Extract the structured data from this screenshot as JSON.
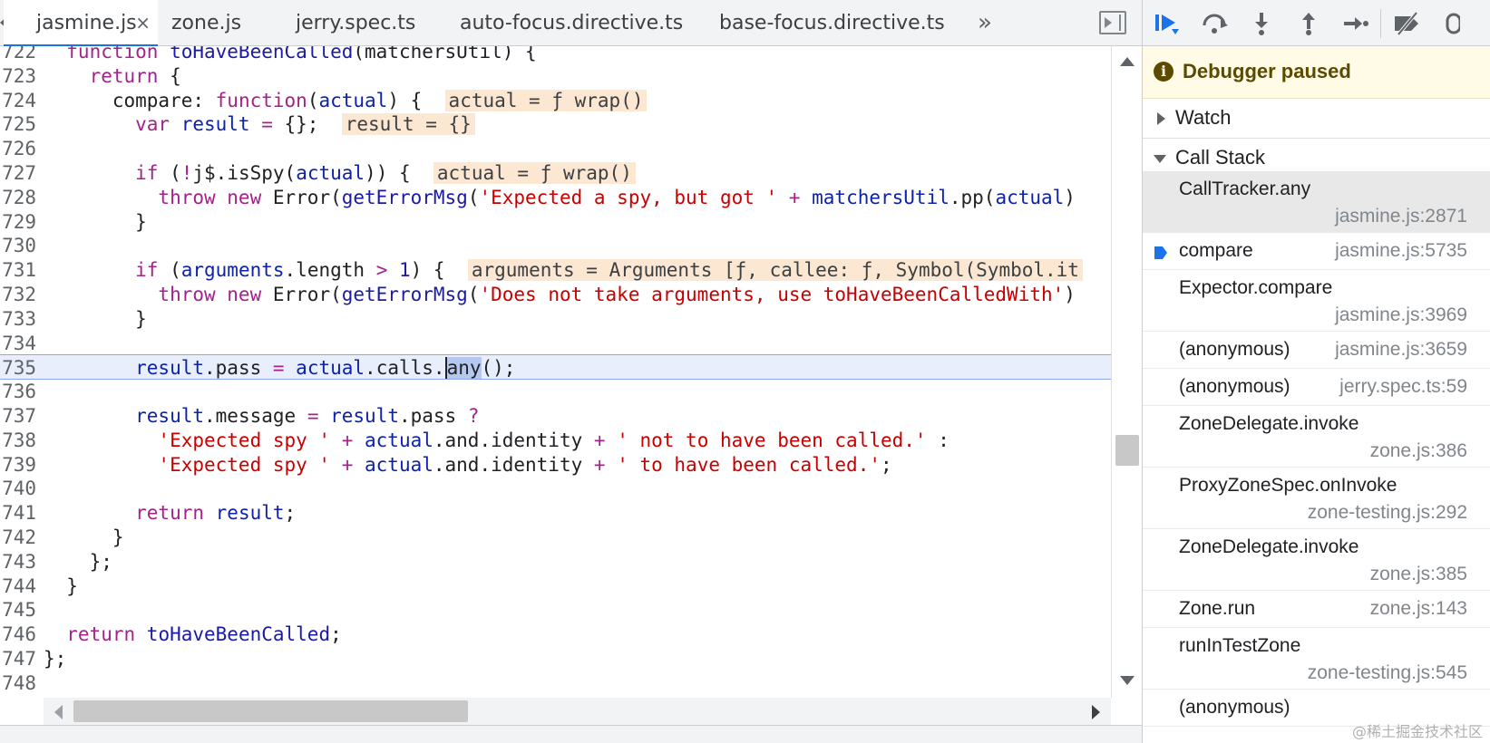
{
  "tabs": [
    {
      "label": "jasmine.js",
      "active": true,
      "close": "×"
    },
    {
      "label": "zone.js"
    },
    {
      "label": "jerry.spec.ts"
    },
    {
      "label": "auto-focus.directive.ts"
    },
    {
      "label": "base-focus.directive.ts"
    }
  ],
  "tabbar": {
    "more_icon": "»"
  },
  "code": {
    "lines": [
      {
        "n": "722",
        "tokens": [
          [
            "kw",
            "  function "
          ],
          [
            "fn",
            "toHaveBeenCalled"
          ],
          [
            "id",
            "(matchersUtil) {"
          ]
        ]
      },
      {
        "n": "723",
        "tokens": [
          [
            "kw",
            "    return "
          ],
          [
            "id",
            "{"
          ]
        ]
      },
      {
        "n": "724",
        "tokens": [
          [
            "id",
            "      compare: "
          ],
          [
            "kw",
            "function"
          ],
          [
            "id",
            "("
          ],
          [
            "prop",
            "actual"
          ],
          [
            "id",
            ") {  "
          ],
          [
            "ann",
            "actual = ƒ wrap()"
          ]
        ]
      },
      {
        "n": "725",
        "tokens": [
          [
            "kw",
            "        var "
          ],
          [
            "prop",
            "result"
          ],
          [
            "op",
            " = "
          ],
          [
            "id",
            "{};  "
          ],
          [
            "ann",
            "result = {}"
          ]
        ]
      },
      {
        "n": "726",
        "tokens": []
      },
      {
        "n": "727",
        "tokens": [
          [
            "kw",
            "        if "
          ],
          [
            "id",
            "("
          ],
          [
            "op",
            "!"
          ],
          [
            "id",
            "j$.isSpy("
          ],
          [
            "prop",
            "actual"
          ],
          [
            "id",
            ")) {  "
          ],
          [
            "ann",
            "actual = ƒ wrap()"
          ]
        ]
      },
      {
        "n": "728",
        "tokens": [
          [
            "kw",
            "          throw new "
          ],
          [
            "id",
            "Error("
          ],
          [
            "fn",
            "getErrorMsg"
          ],
          [
            "id",
            "("
          ],
          [
            "str",
            "'Expected a spy, but got '"
          ],
          [
            "op",
            " + "
          ],
          [
            "prop",
            "matchersUtil"
          ],
          [
            "id",
            ".pp("
          ],
          [
            "prop",
            "actual"
          ],
          [
            "id",
            ")"
          ]
        ]
      },
      {
        "n": "729",
        "tokens": [
          [
            "id",
            "        }"
          ]
        ]
      },
      {
        "n": "730",
        "tokens": []
      },
      {
        "n": "731",
        "tokens": [
          [
            "kw",
            "        if "
          ],
          [
            "id",
            "("
          ],
          [
            "prop",
            "arguments"
          ],
          [
            "id",
            ".length "
          ],
          [
            "op",
            ">"
          ],
          [
            "num",
            " 1"
          ],
          [
            "id",
            ") {  "
          ],
          [
            "ann",
            "arguments = Arguments [ƒ, callee: ƒ, Symbol(Symbol.it"
          ]
        ]
      },
      {
        "n": "732",
        "tokens": [
          [
            "kw",
            "          throw new "
          ],
          [
            "id",
            "Error("
          ],
          [
            "fn",
            "getErrorMsg"
          ],
          [
            "id",
            "("
          ],
          [
            "str",
            "'Does not take arguments, use toHaveBeenCalledWith'"
          ],
          [
            "id",
            ")"
          ]
        ]
      },
      {
        "n": "733",
        "tokens": [
          [
            "id",
            "        }"
          ]
        ]
      },
      {
        "n": "734",
        "tokens": []
      },
      {
        "n": "735",
        "current": true,
        "tokens": [
          [
            "prop",
            "        result"
          ],
          [
            "id",
            ".pass "
          ],
          [
            "op",
            "="
          ],
          [
            "prop",
            " actual"
          ],
          [
            "id",
            ".calls."
          ],
          [
            "sel",
            "any"
          ],
          [
            "id",
            "();"
          ]
        ]
      },
      {
        "n": "736",
        "tokens": []
      },
      {
        "n": "737",
        "tokens": [
          [
            "prop",
            "        result"
          ],
          [
            "id",
            ".message "
          ],
          [
            "op",
            "="
          ],
          [
            "prop",
            " result"
          ],
          [
            "id",
            ".pass "
          ],
          [
            "op",
            "?"
          ]
        ]
      },
      {
        "n": "738",
        "tokens": [
          [
            "str",
            "          'Expected spy '"
          ],
          [
            "op",
            " + "
          ],
          [
            "prop",
            "actual"
          ],
          [
            "id",
            ".and.identity "
          ],
          [
            "op",
            "+"
          ],
          [
            "str",
            " ' not to have been called.'"
          ],
          [
            "id",
            " :"
          ]
        ]
      },
      {
        "n": "739",
        "tokens": [
          [
            "str",
            "          'Expected spy '"
          ],
          [
            "op",
            " + "
          ],
          [
            "prop",
            "actual"
          ],
          [
            "id",
            ".and.identity "
          ],
          [
            "op",
            "+"
          ],
          [
            "str",
            " ' to have been called.'"
          ],
          [
            "id",
            ";"
          ]
        ]
      },
      {
        "n": "740",
        "tokens": []
      },
      {
        "n": "741",
        "tokens": [
          [
            "kw",
            "        return "
          ],
          [
            "prop",
            "result"
          ],
          [
            "id",
            ";"
          ]
        ]
      },
      {
        "n": "742",
        "tokens": [
          [
            "id",
            "      }"
          ]
        ]
      },
      {
        "n": "743",
        "tokens": [
          [
            "id",
            "    };"
          ]
        ]
      },
      {
        "n": "744",
        "tokens": [
          [
            "id",
            "  }"
          ]
        ]
      },
      {
        "n": "745",
        "tokens": []
      },
      {
        "n": "746",
        "tokens": [
          [
            "kw",
            "  return "
          ],
          [
            "fn",
            "toHaveBeenCalled"
          ],
          [
            "id",
            ";"
          ]
        ]
      },
      {
        "n": "747",
        "tokens": [
          [
            "id",
            "};"
          ]
        ]
      },
      {
        "n": "748",
        "tokens": []
      }
    ]
  },
  "debugger": {
    "paused_icon": "i",
    "paused_text": "Debugger paused",
    "watch_label": "Watch",
    "callstack_label": "Call Stack",
    "accent_color": "#1a73e8",
    "frames": [
      {
        "name": "CallTracker.any",
        "loc": "jasmine.js:2871",
        "two_line": true,
        "selected": true
      },
      {
        "name": "compare",
        "loc": "jasmine.js:5735",
        "two_line": false,
        "current": true
      },
      {
        "name": "Expector.compare",
        "loc": "jasmine.js:3969",
        "two_line": true
      },
      {
        "name": "(anonymous)",
        "loc": "jasmine.js:3659",
        "two_line": false
      },
      {
        "name": "(anonymous)",
        "loc": "jerry.spec.ts:59",
        "two_line": false
      },
      {
        "name": "ZoneDelegate.invoke",
        "loc": "zone.js:386",
        "two_line": true
      },
      {
        "name": "ProxyZoneSpec.onInvoke",
        "loc": "zone-testing.js:292",
        "two_line": true
      },
      {
        "name": "ZoneDelegate.invoke",
        "loc": "zone.js:385",
        "two_line": true
      },
      {
        "name": "Zone.run",
        "loc": "zone.js:143",
        "two_line": false
      },
      {
        "name": "runInTestZone",
        "loc": "zone-testing.js:545",
        "two_line": true
      },
      {
        "name": "(anonymous)",
        "loc": "",
        "two_line": false
      }
    ]
  },
  "watermark": "@稀土掘金技术社区"
}
